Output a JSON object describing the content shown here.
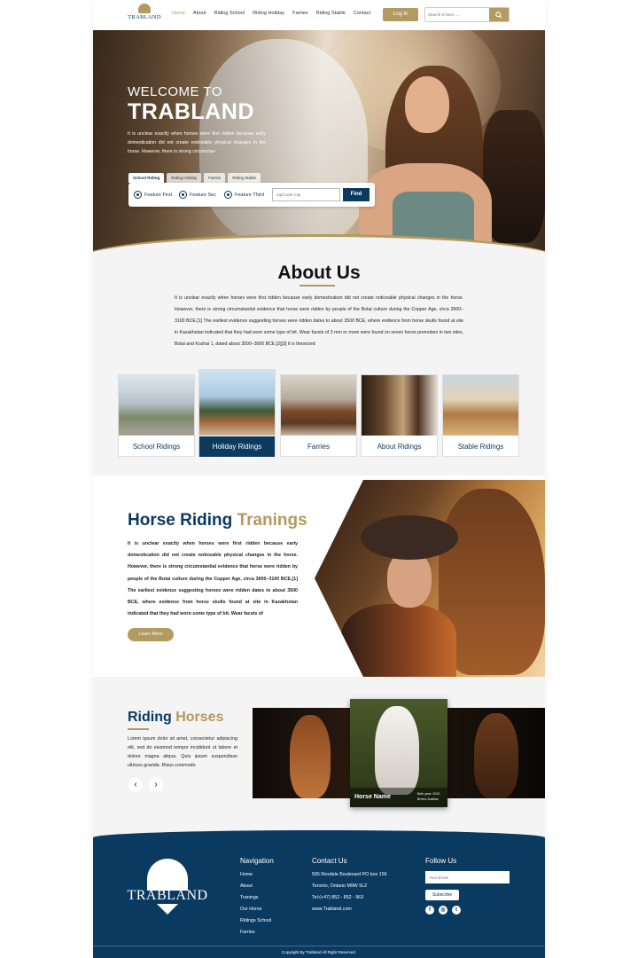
{
  "brand": {
    "name": "TRABLAND"
  },
  "nav": {
    "items": [
      "Home",
      "About",
      "Riding School",
      "Riding Holiday",
      "Farries",
      "Riding Stable",
      "Contact"
    ],
    "active_index": 0,
    "login_label": "Log In",
    "search_placeholder": "Search is here......"
  },
  "hero": {
    "welcome": "WELCOME TO",
    "title": "TRABLAND",
    "text": "It is unclear exactly when horses were first ridden because early domestication did not create noticeable physical changes in the horse. However, there is strong circumstan-",
    "tabs": [
      "School Riding",
      "Riding Holiday",
      "Farries",
      "Riding Stable"
    ],
    "features": [
      "Feature First",
      "Feature Sec",
      "Feature Third"
    ],
    "zip_placeholder": "Zip/Code City",
    "find_label": "Find"
  },
  "about": {
    "title": "About Us",
    "text": "It is unclear exactly when horses were first ridden because early domestication did not create noticeable physical changes in the horse. However, there is strong circumstantial evidence that horse were ridden by people of the Botai culture during the Copper Age, circa 3500–3100 BCE.[1] The earliest evidence suggesting horses were ridden dates to about 3500 BCE, where evidence from horse skulls found at site in Kazakhstan indicated that they had worn some type of bit. Wear facets of 3 mm or more were found on seven horse premolars in two sites, Botai and Kozhai 1, dated about 3500–3000 BCE.[2][3] It is theorized",
    "cards": [
      "School Ridings",
      "Holiday Ridings",
      "Farries",
      "About Ridings",
      "Stable Ridings"
    ],
    "active_card": 1
  },
  "training": {
    "title_main": "Horse Riding",
    "title_accent": "Tranings",
    "text": "It is unclear exactly when horses were first ridden because early domestication did not create noticeable physical changes in the horse. However, there is strong circumstantial evidence that horse were ridden by people of the Botai culture during the Copper Age, circa 3600–3100 BCE.[1] The earliest evidence suggesting horses were ridden dates to about 3500 BCE, where evidence from horse skulls found at site in Kazakhstan indicated that they had worn some type of bit. Wear facets of",
    "button": "Learn More"
  },
  "riding": {
    "title_main": "Riding",
    "title_accent": "Horses",
    "text": "Lorem ipsum dolor sit amet, consectetur adipiscing elit, sed do eiusmod tempor incididunt ut labore et dolore magna aliqua. Quis ipsum suspendisse ultrices gravida. Risus commodo",
    "prev": "‹",
    "next": "›",
    "featured_name": "Horse Name",
    "featured_meta": "Birth year: 2010 Breed: Arabian"
  },
  "footer": {
    "navigation_title": "Navigation",
    "navigation": [
      "Home",
      "About",
      "Tranings",
      "Our Hores",
      "Ridings School",
      "Farries"
    ],
    "contact_title": "Contact Us",
    "contact": [
      "555 Rexdale Boulevard PO box 156",
      "Toronto, Ontario M9W 5L2",
      "Tel:(+47) 852 - 852 - 963",
      "www.Trabland.com"
    ],
    "follow_title": "Follow Us",
    "email_placeholder": "Your Email",
    "subscribe": "Subscribe",
    "social": [
      "f",
      "◎",
      "t"
    ],
    "copyright": "Copyright By Trabland All Right Reserved."
  },
  "colors": {
    "navy": "#0b3a60",
    "gold": "#b39a5e",
    "light_bg": "#f4f4f4"
  }
}
